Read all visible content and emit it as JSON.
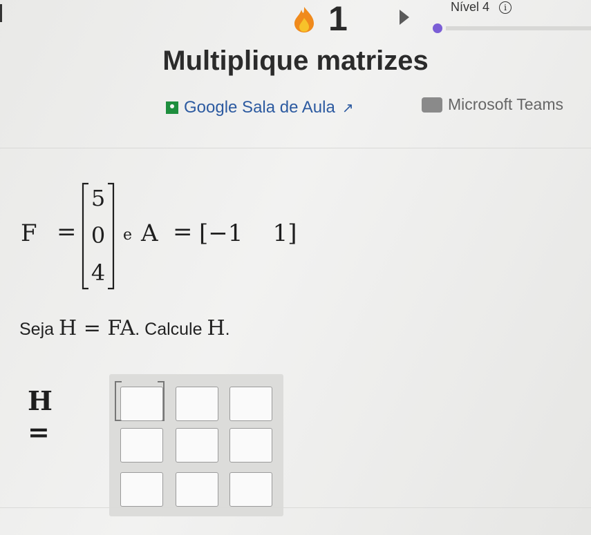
{
  "header": {
    "streak_count": "1",
    "level_label": "Nível 4",
    "info_glyph": "i",
    "progress_color": "#7b5ed6"
  },
  "exercise": {
    "title": "Multiplique matrizes"
  },
  "share": {
    "classroom_label": "Google Sala de Aula",
    "classroom_external_glyph": "↗",
    "teams_label": "Microsoft Teams"
  },
  "definition": {
    "F_name": "F",
    "equals": "=",
    "F_entries": [
      "5",
      "0",
      "4"
    ],
    "conjunction": "e",
    "A_name": "A",
    "A_entries": [
      "−1",
      "1"
    ]
  },
  "question": {
    "prefix": "Seja",
    "equation": "H = FA",
    "middle": ". Calcule",
    "target": "H",
    "suffix": "."
  },
  "answer": {
    "label": "H =",
    "cells": [
      [
        "",
        "",
        ""
      ],
      [
        "",
        "",
        ""
      ],
      [
        "",
        "",
        ""
      ]
    ]
  },
  "icons": {
    "streak": "flame-icon",
    "level_play": "play-icon",
    "info": "info-icon",
    "classroom": "google-classroom-icon",
    "teams": "microsoft-teams-icon"
  }
}
